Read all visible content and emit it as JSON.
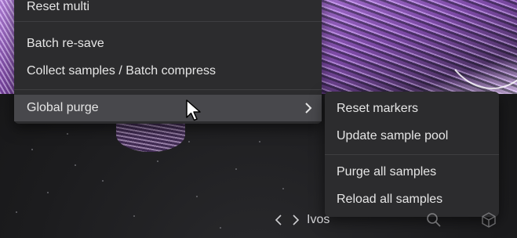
{
  "menu": {
    "items": [
      {
        "label": "Reset multi"
      },
      {
        "label": "Batch re-save"
      },
      {
        "label": "Collect samples / Batch compress"
      },
      {
        "label": "Global purge",
        "has_submenu": true,
        "active": true
      }
    ]
  },
  "submenu": {
    "items": [
      {
        "label": "Reset markers"
      },
      {
        "label": "Update sample pool"
      },
      {
        "label": "Purge all samples"
      },
      {
        "label": "Reload all samples"
      }
    ]
  },
  "bottom_bar": {
    "location": "Ivos",
    "icons": [
      "chevron-left-icon",
      "chevron-right-icon",
      "search-icon",
      "cube-icon"
    ]
  },
  "colors": {
    "menu_bg": "#2c2c2e",
    "menu_active": "#48484c",
    "text": "#e6e6e6",
    "background": "#1e1e20",
    "accent_art": "#b57fe0"
  }
}
